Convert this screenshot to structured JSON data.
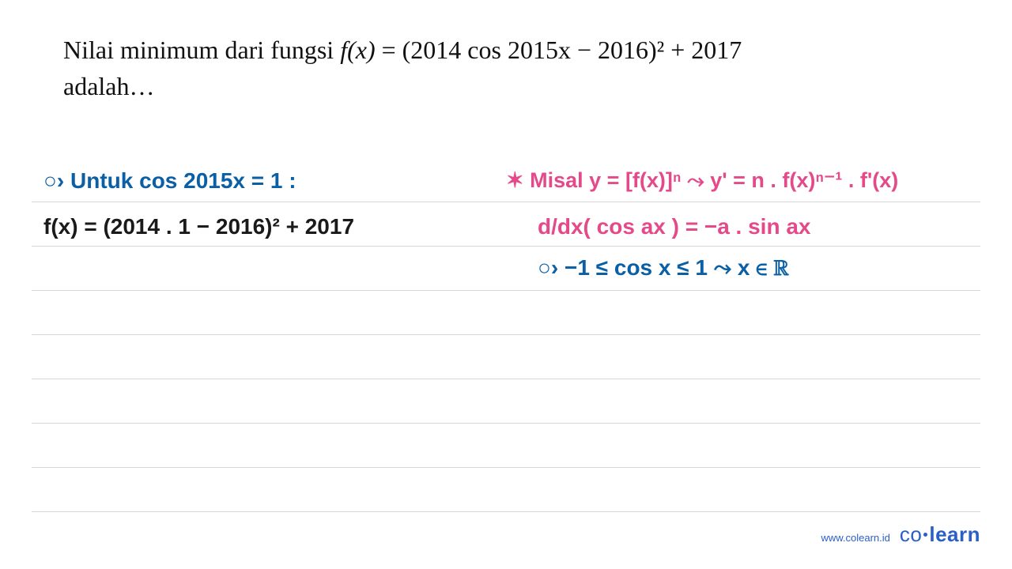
{
  "question": {
    "line1_pre": "Nilai minimum dari fungsi ",
    "line1_fx": "f(x)",
    "line1_post": " = (2014 cos 2015x − 2016)² + 2017",
    "line2": "adalah…"
  },
  "work_left": {
    "line1": "○› Untuk cos 2015x  = 1 :",
    "line2": "f(x) = (2014 . 1 − 2016)²  +  2017"
  },
  "work_right": {
    "line1": "✶ Misal y = [f(x)]ⁿ  ⤳ y' = n . f(x)ⁿ⁻¹ . f'(x)",
    "line2": "d/dx( cos ax ) = −a . sin ax",
    "line3": "○›  −1 ≤ cos x ≤ 1   ⤳  x ∈ ℝ"
  },
  "footer": {
    "url": "www.colearn.id",
    "logo_co": "co",
    "logo_learn": "learn"
  }
}
